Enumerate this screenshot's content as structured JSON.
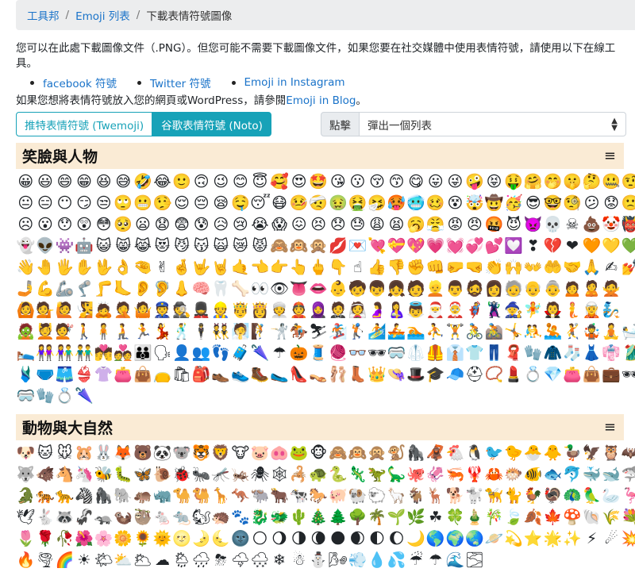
{
  "breadcrumb": {
    "home": "工具邦",
    "list": "Emoji 列表",
    "current": "下載表情符號圖像"
  },
  "intro": "您可以在此處下載圖像文件（.PNG）。但您可能不需要下載圖像文件，如果您要在社交媒體中使用表情符號，請使用以下在線工具。",
  "links": [
    "facebook 符號",
    "Twitter 符號",
    "Emoji in Instagram"
  ],
  "blog_line": {
    "prefix": "如果您想將表情符號放入您的網頁或WordPress，請參閱",
    "link": "Emoji in Blog",
    "suffix": "。"
  },
  "buttons": {
    "twemoji": "推特表情符號 (Twemoji)",
    "noto": "谷歌表情符號 (Noto)"
  },
  "picker": {
    "label": "點擊",
    "value": "彈出一個列表"
  },
  "sections": [
    {
      "title": "笑臉與人物",
      "menu_icon": "≡",
      "rows": [
        "😀😃😄😁😆😅🤣😂🙂🙃😉😊😇🥰😍🤩😘😗😚😙😋😛😜🤪😝🤑🤗🤭🤫🤔🤐🤨",
        "😐😑😶😏😒🙄😬🤥😌😔😪🤤😴😷🤒🤕🤢🤮🤧🥵🥶🥴😵🤯🤠🥳😎🤓🧐😕😟🙁",
        "☹😮😯😲😳🥺😦😧😨😰😥😢😭😱😖😣😞😓😩😫🥱😤😡😠🤬😈👿💀☠💩🤡👹👺",
        "👻👽👾🤖😺😸😹😻😼😽🙀😿😾🙈🙉🙊💋💌💘💝💖💗💓💞💕💟❣💔❤🧡💛💚",
        "👋🤚🖐✋🖖👌🤏✌🤞🤟🤘🤙👈👉👆🖕👇☝👍👎✊👊🤛🤜👏🙌👐🤲🤝🙏✍💅",
        "🤳💪🦾🦿🦵🦶👂🦻👃🧠🦷🦴👀👁👅👄👶🧒👦👧🧑👱👨🧔👩🧓👴👵🙍🙎🙅",
        "🙆💁🙋🧏🙇🤦🤷👮🕵💂👷🤴👸👳👲🧕🤵👰🤰🤱👼🎅🤶🦸🦹🧙🧚🧛🧜🧝🧞",
        "🧟💆💇🚶🧍🧎🏃💃🕺🕴👯🧖🧗🤺🏇⛷🏂🏌🏄🚣🏊⛹🏋🚴🚵🤸🤼🤽🤾🤹🧘🛀",
        "🛌👭👫👬💏💑👪🗣👤👥👣🧳🌂☂🎃🧵🧶👓🕶🥽🥼🦺👔👕👖🧣🧤🧥🧦👗👘🥻",
        "🩱🩲🩳👙👚👛👜👝🛍🎒👞👟🥾🥿👠👡🩰👢👑👒🎩🎓🧢⛑📿💄💍💎👛👜💼🕶",
        "🥽🧤💍🌂"
      ]
    },
    {
      "title": "動物與大自然",
      "menu_icon": "≡",
      "rows": [
        "🐶🐱🐭🐹🐰🦊🐻🐼🐨🐯🦁🐮🐷🐽🐸🐵🙈🙉🙊🐒🦍🦧🐔🐧🐦🐤🐣🐥🦆🦅🦉🦇",
        "🐺🐗🐴🦄🐝🐛🦋🐌🐞🐜🦟🦗🕷🕸🦂🐢🐍🦎🦖🦕🐙🦑🦐🦞🦀🐡🐠🐟🐬🐳🐋🦈",
        "🐊🐅🐆🦓🦍🐘🦛🦏🐪🐫🦒🦘🐃🐂🐄🐎🐖🐏🐑🦙🐐🦌🐕🐩🦮🐈🐓🦃🦚🦜🦢🦩",
        "🕊🐇🦝🦨🦡🦦🦥🐁🐀🐿🦔🐾🐉🐲🌵🎄🌲🌳🌴🌱🌿☘🍀🎍🎋🍃🍂🍁🍄🐚🌾💐",
        "🌷🌹🥀🌺🌸🌼🌻🌞🌝🌛🌜🌚🌕🌖🌗🌘🌑🌒🌓🌔🌙🌎🌍🌏🪐💫⭐🌟✨⚡☄💥",
        "🔥🌪🌈☀🌤⛅🌥☁🌦🌧⛈🌩🌨❄☃⛄🌬💨💧💦☔☂🌊🌫"
      ]
    }
  ]
}
